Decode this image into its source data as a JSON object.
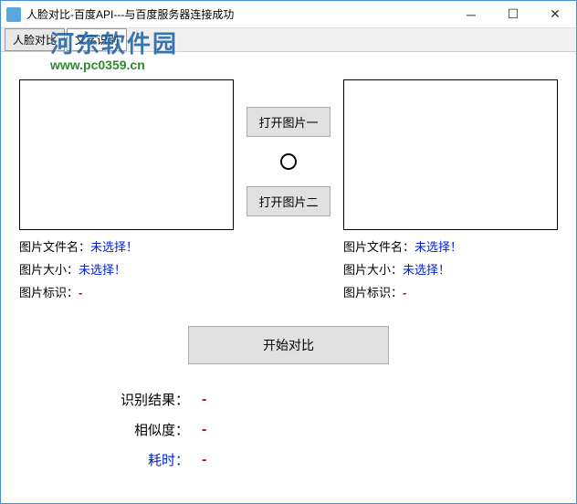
{
  "titlebar": {
    "title": "人脸对比-百度API---与百度服务器连接成功"
  },
  "toolbar": {
    "tab1": "人脸对比",
    "tab2": "文字识别"
  },
  "watermark": {
    "main": "河东软件园",
    "url": "www.pc0359.cn"
  },
  "buttons": {
    "open1": "打开图片一",
    "open2": "打开图片二",
    "start": "开始对比"
  },
  "left": {
    "filename_label": "图片文件名：",
    "filename_val": "未选择！",
    "size_label": "图片大小：",
    "size_val": "未选择！",
    "id_label": "图片标识：",
    "id_val": "-"
  },
  "right": {
    "filename_label": "图片文件名：",
    "filename_val": "未选择！",
    "size_label": "图片大小：",
    "size_val": "未选择！",
    "id_label": "图片标识：",
    "id_val": "-"
  },
  "results": {
    "result_label": "识别结果：",
    "result_val": "-",
    "similarity_label": "相似度：",
    "similarity_val": "-",
    "time_label": "耗时：",
    "time_val": "-"
  }
}
